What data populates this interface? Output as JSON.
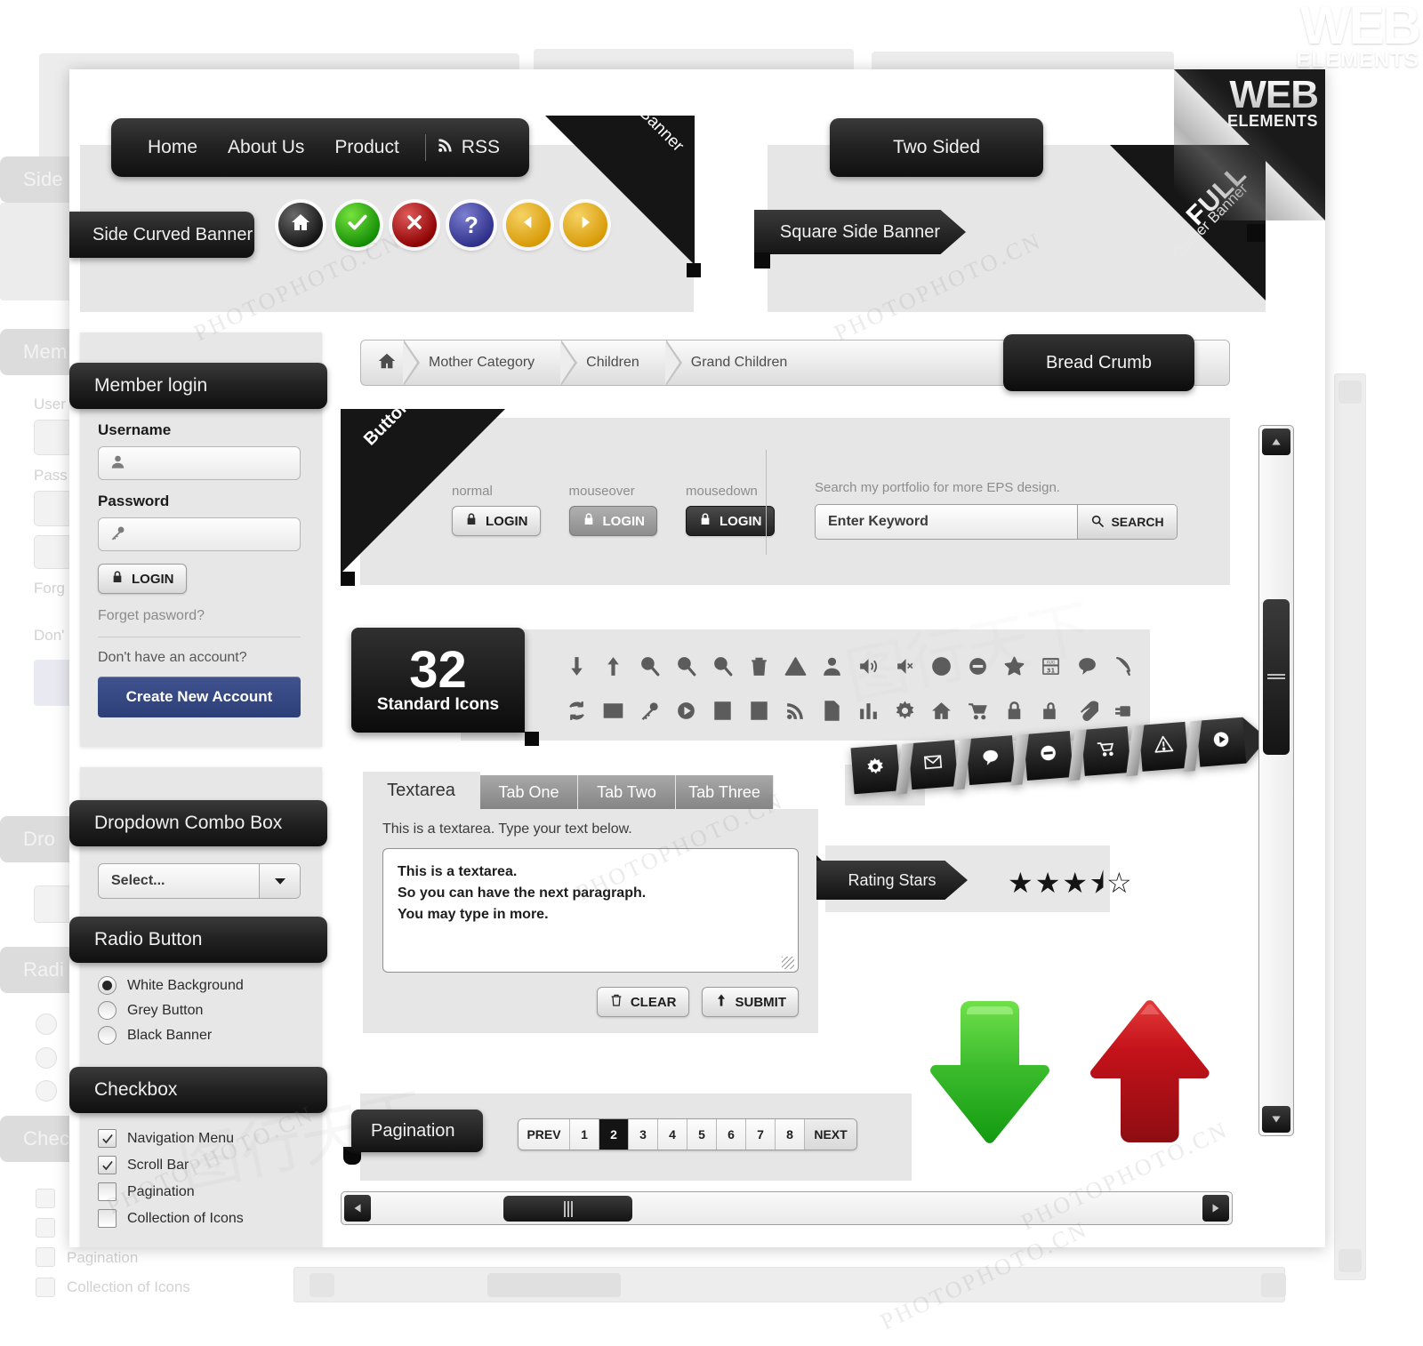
{
  "brand": {
    "line1": "WEB",
    "line2": "ELEMENTS"
  },
  "corner_banner": {
    "label": "Corner Banner"
  },
  "full_corner_banner": {
    "line1": "FULL",
    "line2": "Corner Banner"
  },
  "topnav": {
    "items": [
      "Home",
      "About Us",
      "Product"
    ],
    "rss_label": "RSS",
    "rss_icon": "rss-icon"
  },
  "side_curved_banner": {
    "label": "Side Curved Banner"
  },
  "two_sided_banner": {
    "label": "Two Sided"
  },
  "square_side_banner": {
    "label": "Square Side Banner"
  },
  "circle_buttons": [
    {
      "name": "home",
      "icon": "home-icon",
      "color": "#161616"
    },
    {
      "name": "check",
      "icon": "check-icon",
      "color": "#128c05"
    },
    {
      "name": "close",
      "icon": "close-icon",
      "color": "#8b0000"
    },
    {
      "name": "help",
      "icon": "question-icon",
      "color": "#2c2e88"
    },
    {
      "name": "previous",
      "icon": "arrow-left-icon",
      "color": "#d79a06"
    },
    {
      "name": "next",
      "icon": "arrow-right-icon",
      "color": "#d79a06"
    }
  ],
  "member_login": {
    "title": "Member login",
    "username_label": "Username",
    "username_placeholder": "",
    "username_icon": "user-icon",
    "password_label": "Password",
    "password_icon": "key-icon",
    "login_button": "LOGIN",
    "login_icon": "lock-icon",
    "forgot_link": "Forget pasword?",
    "no_account_text": "Don't have an account?",
    "create_account_button": "Create New Account",
    "accent_color": "#2d3f78"
  },
  "breadcrumb": {
    "home_icon": "home-icon",
    "items": [
      "Mother Category",
      "Children",
      "Grand Children"
    ],
    "tab_label": "Bread Crumb"
  },
  "buttons_block": {
    "ribbon_label": "Buttons",
    "states": [
      {
        "caption": "normal",
        "label": "LOGIN"
      },
      {
        "caption": "mouseover",
        "label": "LOGIN"
      },
      {
        "caption": "mousedown",
        "label": "LOGIN"
      }
    ],
    "button_icon": "lock-icon"
  },
  "search_block": {
    "hint": "Search my portfolio for more EPS design.",
    "input_value": "Enter Keyword",
    "search_button": "SEARCH",
    "search_icon": "search-icon"
  },
  "icons_block": {
    "count": "32",
    "caption": "Standard Icons",
    "row1": [
      "arrow-down-icon",
      "arrow-up-icon",
      "zoom-in-icon",
      "zoom-out-icon",
      "search-icon",
      "trash-icon",
      "warning-icon",
      "user-icon",
      "volume-on-icon",
      "volume-mute-icon",
      "clock-icon",
      "minus-circle-icon",
      "star-icon",
      "calendar-icon",
      "comment-icon",
      "phone-icon"
    ],
    "row2": [
      "refresh-icon",
      "mail-icon",
      "key-icon",
      "play-icon",
      "collapse-down-icon",
      "collapse-up-icon",
      "rss-icon",
      "document-icon",
      "chart-icon",
      "gear-icon",
      "home-icon",
      "cart-icon",
      "lock-closed-icon",
      "lock-open-icon",
      "paperclip-icon",
      "plug-icon"
    ]
  },
  "dropdown_section": {
    "title": "Dropdown Combo Box",
    "select_value": "Select...",
    "chevron_icon": "chevron-down-icon"
  },
  "radio_section": {
    "title": "Radio Button",
    "options": [
      {
        "label": "White Background",
        "checked": true
      },
      {
        "label": "Grey Button",
        "checked": false
      },
      {
        "label": "Black Banner",
        "checked": false
      }
    ]
  },
  "checkbox_section": {
    "title": "Checkbox",
    "options": [
      {
        "label": "Navigation Menu",
        "checked": true
      },
      {
        "label": "Scroll Bar",
        "checked": true
      },
      {
        "label": "Pagination",
        "checked": false
      },
      {
        "label": "Collection of Icons",
        "checked": false
      }
    ]
  },
  "tabs_block": {
    "tabs": [
      {
        "label": "Textarea",
        "active": true
      },
      {
        "label": "Tab One",
        "active": false
      },
      {
        "label": "Tab Two",
        "active": false
      },
      {
        "label": "Tab Three",
        "active": false
      }
    ],
    "hint": "This is a textarea. Type your text below.",
    "textarea_line1": "This is a textarea.",
    "textarea_line2": "So you can have the next paragraph.",
    "textarea_line3": "You may type in more.",
    "clear_button": "CLEAR",
    "clear_icon": "trash-icon",
    "submit_button": "SUBMIT",
    "submit_icon": "arrow-up-icon"
  },
  "ribbon_tools": {
    "icons": [
      "gear-icon",
      "mail-icon",
      "comment-icon",
      "minus-circle-icon",
      "cart-icon",
      "warning-icon",
      "play-icon"
    ]
  },
  "rating": {
    "label": "Rating Stars",
    "value": 3.5,
    "max": 5,
    "display": "★★★⯨☆"
  },
  "arrows": {
    "down": {
      "name": "arrow-down-big",
      "color": "#2fad28"
    },
    "up": {
      "name": "arrow-up-big",
      "color": "#c8111a"
    }
  },
  "pagination": {
    "label": "Pagination",
    "prev": "PREV",
    "next": "NEXT",
    "pages": [
      "1",
      "2",
      "3",
      "4",
      "5",
      "6",
      "7",
      "8"
    ],
    "current": "2"
  },
  "scrollbars": {
    "vertical": {
      "up_icon": "triangle-up-icon",
      "down_icon": "triangle-down-icon"
    },
    "horizontal": {
      "left_icon": "triangle-left-icon",
      "right_icon": "triangle-right-icon"
    }
  },
  "watermark": {
    "text_small": "PHOTOPHOTO.CN",
    "text_big": "图行天下"
  }
}
